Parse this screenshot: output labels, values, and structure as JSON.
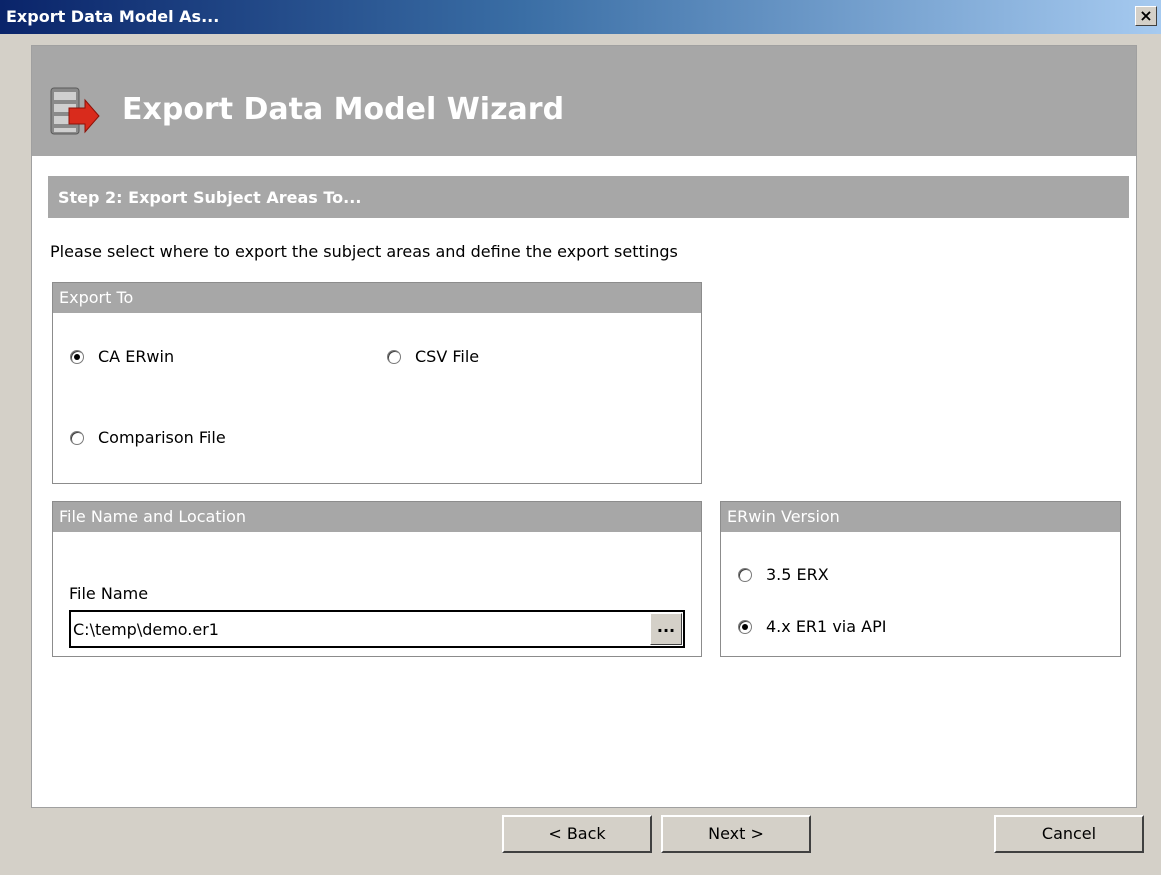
{
  "window": {
    "title": "Export Data Model As...",
    "close_glyph": "×"
  },
  "wizard": {
    "title": "Export Data Model Wizard",
    "icon": "export-database-icon"
  },
  "step": {
    "title": "Step 2: Export Subject Areas To...",
    "instructions": "Please select where to export the subject areas and define the export settings"
  },
  "export_to": {
    "header": "Export To",
    "options": [
      {
        "label": "CA ERwin",
        "checked": true
      },
      {
        "label": "CSV File",
        "checked": false
      },
      {
        "label": "Comparison File",
        "checked": false
      }
    ]
  },
  "file_location": {
    "header": "File Name and Location",
    "field_label": "File Name",
    "value": "C:\\temp\\demo.er1",
    "browse_label": "..."
  },
  "erwin_version": {
    "header": "ERwin Version",
    "options": [
      {
        "label": "3.5 ERX",
        "checked": false
      },
      {
        "label": "4.x ER1 via API",
        "checked": true
      }
    ]
  },
  "buttons": {
    "back": "< Back",
    "next": "Next >",
    "cancel": "Cancel"
  },
  "colors": {
    "title_gradient_start": "#0a246a",
    "title_gradient_end": "#a6caf0",
    "header_gray": "#a7a7a7",
    "dialog_face": "#d4d0c8"
  }
}
